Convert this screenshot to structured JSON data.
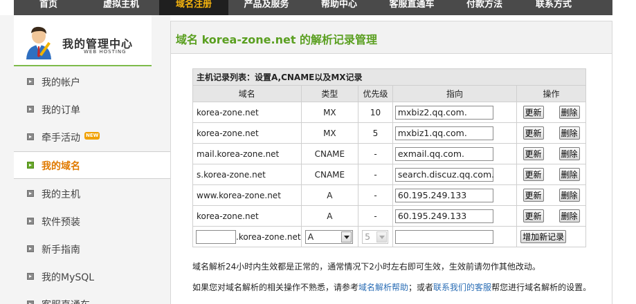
{
  "nav": {
    "items": [
      "首页",
      "虚拟主机",
      "域名注册",
      "产品及服务",
      "帮助中心",
      "客服直通车",
      "付款方法",
      "联系方式"
    ],
    "active_index": 2
  },
  "sidebar": {
    "title": "我的管理中心",
    "subtitle": "WEB HOSTING",
    "items": [
      {
        "label": "我的帐户"
      },
      {
        "label": "我的订单"
      },
      {
        "label": "牵手活动",
        "badge": "NEW"
      },
      {
        "label": "我的域名",
        "active": true
      },
      {
        "label": "我的主机"
      },
      {
        "label": "软件预装"
      },
      {
        "label": "新手指南"
      },
      {
        "label": "我的MySQL"
      },
      {
        "label": "客服直通车"
      }
    ]
  },
  "main": {
    "title": "域名 korea-zone.net 的解析记录管理",
    "table": {
      "caption": "主机记录列表：设置A,CNAME以及MX记录",
      "headers": [
        "域名",
        "类型",
        "优先级",
        "指向",
        "操作"
      ],
      "update_label": "更新",
      "delete_label": "删除",
      "rows": [
        {
          "domain": "korea-zone.net",
          "type": "MX",
          "priority": "10",
          "target": "mxbiz2.qq.com."
        },
        {
          "domain": "korea-zone.net",
          "type": "MX",
          "priority": "5",
          "target": "mxbiz1.qq.com."
        },
        {
          "domain": "mail.korea-zone.net",
          "type": "CNAME",
          "priority": "-",
          "target": "exmail.qq.com."
        },
        {
          "domain": "s.korea-zone.net",
          "type": "CNAME",
          "priority": "-",
          "target": "search.discuz.qq.com."
        },
        {
          "domain": "www.korea-zone.net",
          "type": "A",
          "priority": "-",
          "target": "60.195.249.133"
        },
        {
          "domain": "korea-zone.net",
          "type": "A",
          "priority": "-",
          "target": "60.195.249.133"
        }
      ],
      "new_row": {
        "host_value": "",
        "domain_suffix": ".korea-zone.net",
        "type_selected": "A",
        "priority_selected": "5",
        "target_value": "",
        "add_label": "增加新记录"
      }
    },
    "note1": "域名解析24小时内生效都是正常的，通常情况下2小时左右即可生效，生效前请勿作其他改动。",
    "note2": {
      "prefix": "如果您对域名解析的相关操作不熟悉，请参考",
      "link1": "域名解析帮助",
      "middle": "；或者",
      "link2": "联系我们的客服",
      "suffix": "帮您进行域名解析的设置。"
    }
  },
  "colors": {
    "nav_bg": "#4a4a4a",
    "nav_active_text": "#f6b40e",
    "title_green": "#5a9f20",
    "active_orange": "#e07a00",
    "link_blue": "#2a6db5"
  }
}
